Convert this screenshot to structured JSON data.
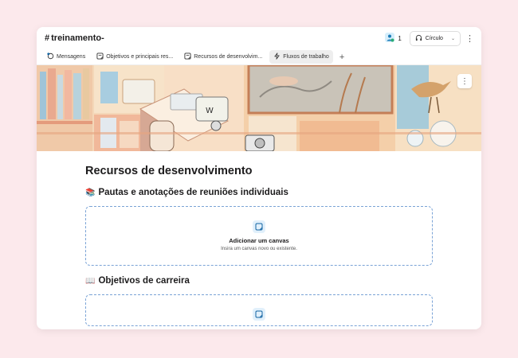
{
  "header": {
    "channel_name": "treinamento-",
    "member_count": "1",
    "huddle_label": "Círculo"
  },
  "tabs": [
    {
      "label": "Mensagens",
      "icon": "messages-icon"
    },
    {
      "label": "Objetivos e principais res...",
      "icon": "canvas-icon"
    },
    {
      "label": "Recursos de desenvolvim...",
      "icon": "canvas-icon"
    },
    {
      "label": "Fluxos de trabalho",
      "icon": "workflow-icon",
      "active": true
    }
  ],
  "document": {
    "title": "Recursos de desenvolvimento",
    "sections": [
      {
        "emoji": "📚",
        "title": "Pautas e anotações de reuniões individuais",
        "canvas_title": "Adicionar um canvas",
        "canvas_subtitle": "Insira um canvas novo ou existente."
      },
      {
        "emoji": "📖",
        "title": "Objetivos de carreira"
      }
    ]
  },
  "colors": {
    "background": "#fce9ec",
    "accent": "#1264a3",
    "dashed_border": "#7aa3d6",
    "canvas_icon_bg": "#e1f0fb"
  }
}
